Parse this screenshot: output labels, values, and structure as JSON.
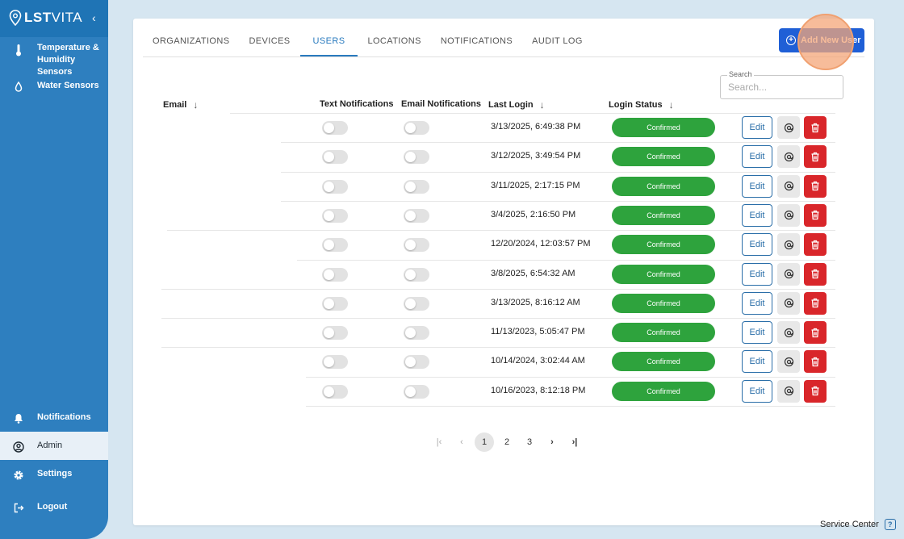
{
  "app": {
    "logo_bold": "LST",
    "logo_thin": "VITA",
    "collapse_icon": "chevron-left-icon"
  },
  "sidebar": {
    "items": [
      {
        "label": "Temperature & Humidity Sensors",
        "icon": "thermometer-icon"
      },
      {
        "label": "Water Sensors",
        "icon": "water-drop-icon"
      },
      {
        "label": "Notifications",
        "icon": "bell-icon"
      },
      {
        "label": "Admin",
        "icon": "user-circle-icon",
        "active": true
      },
      {
        "label": "Settings",
        "icon": "gear-icon"
      },
      {
        "label": "Logout",
        "icon": "logout-icon"
      }
    ]
  },
  "tabs": [
    "ORGANIZATIONS",
    "DEVICES",
    "USERS",
    "LOCATIONS",
    "NOTIFICATIONS",
    "AUDIT LOG"
  ],
  "active_tab": "USERS",
  "toolbar": {
    "add_user_label": "Add New User"
  },
  "search": {
    "label": "Search",
    "placeholder": "Search..."
  },
  "table": {
    "headers": {
      "email": "Email",
      "text_notifications": "Text Notifications",
      "email_notifications": "Email Notifications",
      "last_login": "Last Login",
      "login_status": "Login Status"
    },
    "edit_label": "Edit",
    "rows": [
      {
        "email": "",
        "text_on": false,
        "email_on": false,
        "last_login": "3/13/2025, 6:49:38 PM",
        "status": "Confirmed"
      },
      {
        "email": "",
        "text_on": false,
        "email_on": false,
        "last_login": "3/12/2025, 3:49:54 PM",
        "status": "Confirmed"
      },
      {
        "email": "",
        "text_on": false,
        "email_on": false,
        "last_login": "3/11/2025, 2:17:15 PM",
        "status": "Confirmed"
      },
      {
        "email": "",
        "text_on": false,
        "email_on": false,
        "last_login": "3/4/2025, 2:16:50 PM",
        "status": "Confirmed"
      },
      {
        "email": "",
        "text_on": false,
        "email_on": false,
        "last_login": "12/20/2024, 12:03:57 PM",
        "status": "Confirmed"
      },
      {
        "email": "",
        "text_on": false,
        "email_on": false,
        "last_login": "3/8/2025, 6:54:32 AM",
        "status": "Confirmed"
      },
      {
        "email": "",
        "text_on": false,
        "email_on": false,
        "last_login": "3/13/2025, 8:16:12 AM",
        "status": "Confirmed"
      },
      {
        "email": "",
        "text_on": false,
        "email_on": false,
        "last_login": "11/13/2023, 5:05:47 PM",
        "status": "Confirmed"
      },
      {
        "email": "",
        "text_on": false,
        "email_on": false,
        "last_login": "10/14/2024, 3:02:44 AM",
        "status": "Confirmed"
      },
      {
        "email": "",
        "text_on": false,
        "email_on": false,
        "last_login": "10/16/2023, 8:12:18 PM",
        "status": "Confirmed"
      }
    ]
  },
  "pagination": {
    "pages": [
      "1",
      "2",
      "3"
    ],
    "current": "1"
  },
  "footer": {
    "service_center": "Service Center",
    "help_icon": "?"
  },
  "colors": {
    "sidebar": "#2e7fbf",
    "accent": "#1f5fd6",
    "confirmed": "#2ea33d",
    "delete": "#d9262a"
  }
}
